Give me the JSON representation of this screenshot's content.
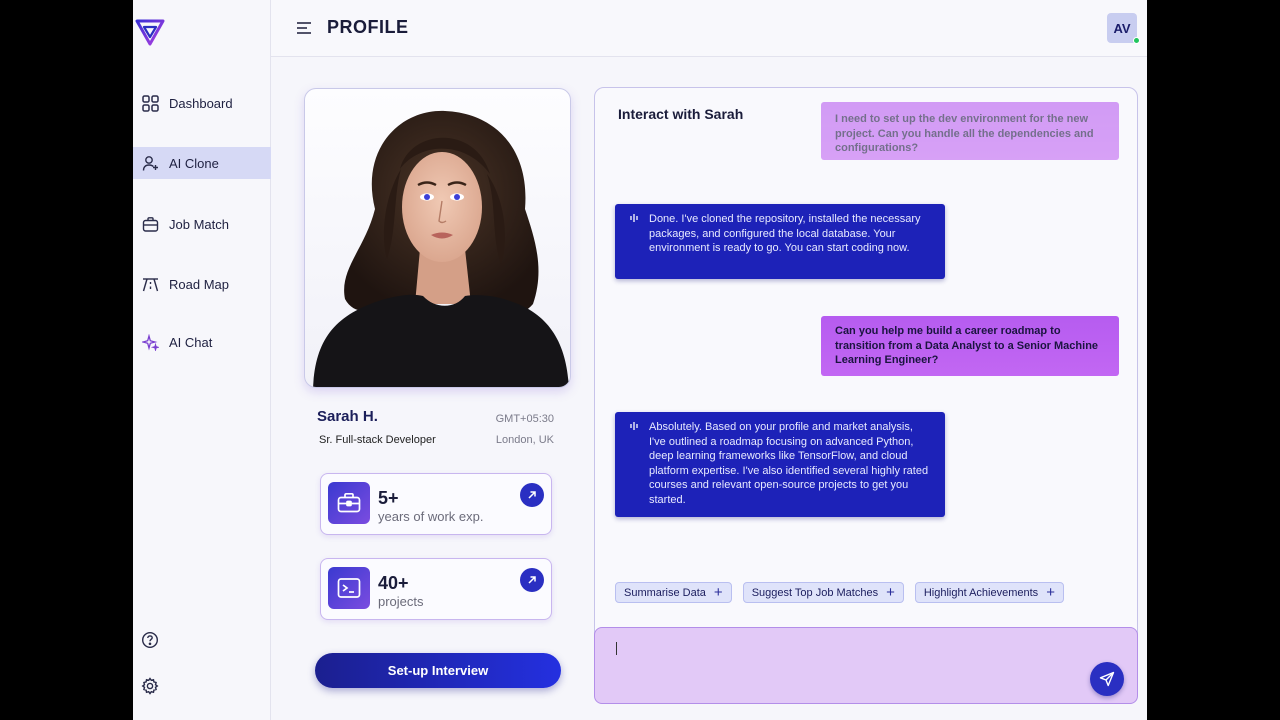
{
  "header": {
    "title": "PROFILE",
    "avatar_initials": "AV"
  },
  "sidebar": {
    "items": [
      {
        "label": "Dashboard",
        "icon": "grid-icon"
      },
      {
        "label": "AI Clone",
        "icon": "user-plus-icon",
        "active": true
      },
      {
        "label": "Job Match",
        "icon": "briefcase-icon"
      },
      {
        "label": "Road Map",
        "icon": "road-icon"
      },
      {
        "label": "AI Chat",
        "icon": "sparkle-icon"
      }
    ],
    "bottom_icons": [
      "help-icon",
      "settings-icon"
    ]
  },
  "profile": {
    "name": "Sarah H.",
    "role": "Sr. Full-stack Developer",
    "timezone": "GMT+05:30",
    "location": "London, UK",
    "stats": [
      {
        "value": "5+",
        "label": "years of work exp.",
        "icon": "briefcase-icon"
      },
      {
        "value": "40+",
        "label": "projects",
        "icon": "terminal-icon"
      }
    ],
    "interview_button": "Set-up Interview"
  },
  "chat": {
    "title": "Interact with Sarah",
    "messages": [
      {
        "from": "user",
        "text": "I need to set up the dev environment for the new project. Can you handle all the dependencies and configurations?"
      },
      {
        "from": "bot",
        "text": "Done. I've cloned the repository, installed the necessary packages, and configured the local database. Your environment is ready to go. You can start coding now."
      },
      {
        "from": "user",
        "text": "Can you help me build a career roadmap to transition from a Data Analyst to a Senior Machine Learning Engineer?"
      },
      {
        "from": "bot",
        "text": "Absolutely. Based on your profile and market analysis, I've outlined a roadmap focusing on advanced Python, deep learning frameworks like TensorFlow, and cloud platform expertise. I've also identified several highly rated courses and relevant open-source projects to get you started."
      }
    ],
    "suggestions": [
      "Summarise Data",
      "Suggest Top Job Matches",
      "Highlight Achievements"
    ],
    "input_value": ""
  },
  "colors": {
    "accent": "#2a2fc2",
    "user_bubble": "#c267f3",
    "bot_bubble": "#1d22b8",
    "active_nav": "#d6d9f5"
  }
}
